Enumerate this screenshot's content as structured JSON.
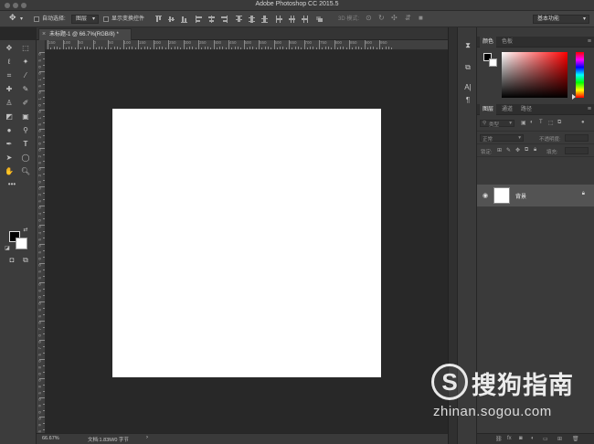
{
  "window": {
    "title": "Adobe Photoshop CC 2015.5"
  },
  "options_bar": {
    "auto_select_label": "自动选择:",
    "auto_select_target": "图层",
    "show_transform_label": "显示变换控件",
    "mode_3d_label": "3D 模式:",
    "workspace": "基本功能"
  },
  "document": {
    "tab_title": "未标题-1 @ 66.7%(RGB/8) *",
    "close_glyph": "×",
    "canvas_color": "#ffffff"
  },
  "ruler": {
    "h_labels": [
      "150",
      "100",
      "50",
      "0",
      "50",
      "100",
      "150",
      "200",
      "250",
      "300",
      "350",
      "400",
      "450",
      "500",
      "550",
      "600",
      "650",
      "700",
      "750",
      "800",
      "850",
      "900",
      "950"
    ],
    "v_labels": [
      "0",
      "5",
      "0",
      "0",
      "1",
      "5",
      "0",
      "1",
      "0",
      "0",
      "1",
      "5",
      "0",
      "2",
      "0",
      "0",
      "2",
      "5",
      "0",
      "3",
      "0",
      "0",
      "3",
      "5",
      "0",
      "4",
      "0",
      "0",
      "4",
      "5",
      "0",
      "5",
      "0",
      "0",
      "5",
      "5",
      "0",
      "6",
      "0",
      "0",
      "6",
      "5",
      "0",
      "7",
      "0",
      "0",
      "7",
      "5",
      "0",
      "8",
      "0",
      "0",
      "8",
      "5",
      "0",
      "9",
      "0",
      "0",
      "9",
      "5",
      "0"
    ]
  },
  "status": {
    "zoom": "66.67%",
    "doc_info": "文档:1.83M/0 字节"
  },
  "panels": {
    "color_tabs": [
      "颜色",
      "色板"
    ],
    "layers_tabs": [
      "图层",
      "通道",
      "路径"
    ],
    "kind_filter": "类型",
    "blend_mode": "正常",
    "opacity_label": "不透明度:",
    "lock_label": "锁定:",
    "fill_label": "填充:",
    "layer_name": "背景"
  },
  "watermark": {
    "brand": "搜狗指南",
    "url": "zhinan.sogou.com"
  },
  "colors": {
    "foreground": "#000000",
    "background": "#ffffff",
    "accent": "#e02020"
  }
}
